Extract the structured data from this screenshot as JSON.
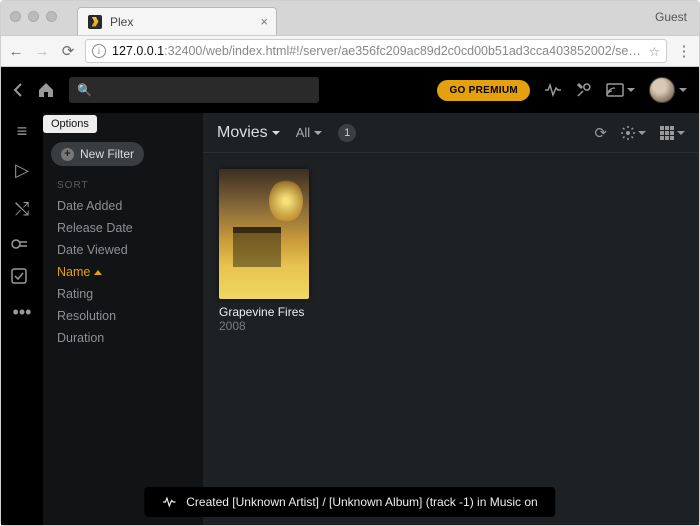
{
  "browser": {
    "tab_title": "Plex",
    "guest_label": "Guest",
    "url_host": "127.0.0.1",
    "url_rest": ":32400/web/index.html#!/server/ae356fc209ac89d2c0cd00b51ad3cca403852002/se…"
  },
  "topbar": {
    "premium_label": "GO PREMIUM",
    "search_placeholder": ""
  },
  "panel": {
    "options_label": "Options",
    "new_filter_label": "New Filter",
    "sort_header": "SORT",
    "sort_items": [
      "Date Added",
      "Release Date",
      "Date Viewed",
      "Name",
      "Rating",
      "Resolution",
      "Duration"
    ],
    "active_sort": "Name"
  },
  "header": {
    "title": "Movies",
    "filter": "All",
    "count": "1"
  },
  "items": [
    {
      "title": "Grapevine Fires",
      "year": "2008"
    }
  ],
  "toast": {
    "message": "Created [Unknown Artist] / [Unknown Album] (track -1) in Music on"
  }
}
